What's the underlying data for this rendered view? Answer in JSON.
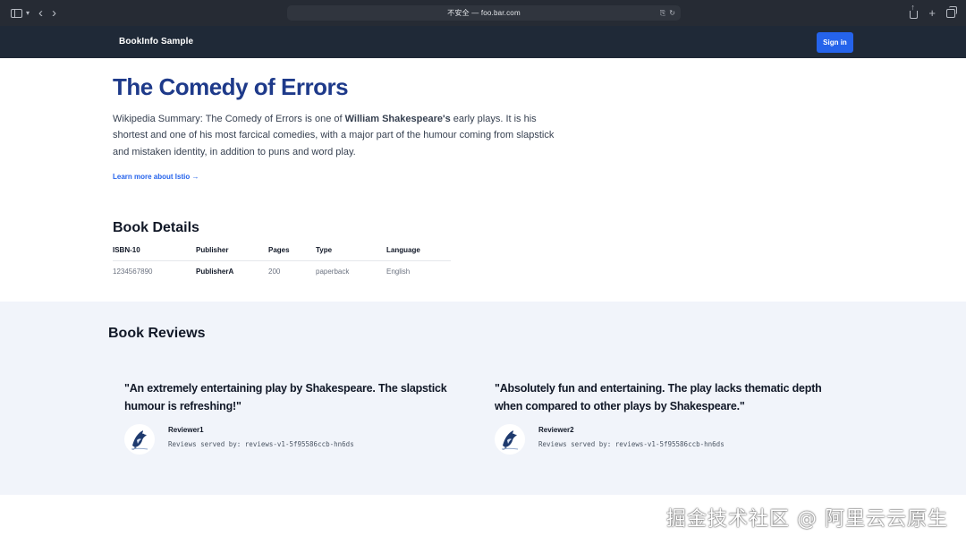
{
  "browser": {
    "address": "不安全 — foo.bar.com",
    "icons": [
      "sidebar-icon",
      "chevron-down-icon",
      "back-icon",
      "forward-icon",
      "translate-icon",
      "reload-icon",
      "share-icon",
      "new-tab-icon",
      "tabs-overview-icon"
    ]
  },
  "navbar": {
    "brand": "BookInfo Sample",
    "signin_label": "Sign in"
  },
  "book": {
    "title": "The Comedy of Errors",
    "summary_prefix": "Wikipedia Summary: The Comedy of Errors is one of ",
    "summary_bold": "William Shakespeare's",
    "summary_suffix": " early plays. It is his shortest and one of his most farcical comedies, with a major part of the humour coming from slapstick and mistaken identity, in addition to puns and word play.",
    "learn_more": "Learn more about Istio →"
  },
  "details": {
    "title": "Book Details",
    "columns": [
      "ISBN-10",
      "Publisher",
      "Pages",
      "Type",
      "Language"
    ],
    "row": [
      "1234567890",
      "PublisherA",
      "200",
      "paperback",
      "English"
    ]
  },
  "reviews": {
    "title": "Book Reviews",
    "items": [
      {
        "quote": "\"An extremely entertaining play by Shakespeare. The slapstick humour is refreshing!\"",
        "reviewer": "Reviewer1",
        "meta": "Reviews served by: reviews-v1-5f95586ccb-hn6ds"
      },
      {
        "quote": "\"Absolutely fun and entertaining. The play lacks thematic depth when compared to other plays by Shakespeare.\"",
        "reviewer": "Reviewer2",
        "meta": "Reviews served by: reviews-v1-5f95586ccb-hn6ds"
      }
    ]
  },
  "watermark": "掘金技术社区 @ 阿里云云原生",
  "colors": {
    "chrome": "#262b34",
    "navbar": "#1f2937",
    "accent": "#2563eb",
    "title": "#1e3a8a",
    "reviews_bg": "#f1f4fa"
  }
}
